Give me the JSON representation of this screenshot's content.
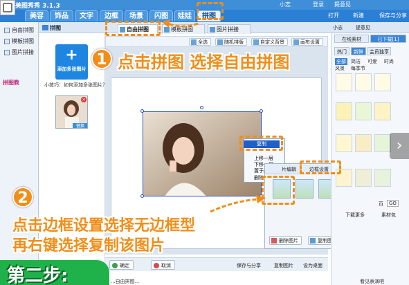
{
  "app": {
    "title": "美图秀秀 3.1.3",
    "user": "小志",
    "links": [
      "登录",
      "提意见"
    ]
  },
  "menu": {
    "tabs": [
      "美容",
      "饰品",
      "文字",
      "边框",
      "场景",
      "闪图",
      "娃娃",
      "拼图"
    ],
    "active": "拼图",
    "actions": {
      "open": "打开",
      "new": "新建",
      "save_share": "保存与分享"
    }
  },
  "subbar": {
    "title": "拼图",
    "user": "小志",
    "feedback": "提意见"
  },
  "sidebar": {
    "items": [
      "自由拼图",
      "模板拼图",
      "图片拼接"
    ],
    "pin_label": "拼图教"
  },
  "mode_tabs": [
    {
      "label": "自由拼图",
      "active": true
    },
    {
      "label": "模板拼图",
      "active": false
    },
    {
      "label": "图片拼接",
      "active": false
    }
  ],
  "left_panel": {
    "add_button": "添加多张图片",
    "tip": "小技巧：如何添加多张图片？",
    "thumb_action": "替换"
  },
  "toolbar": {
    "select_all": "全选",
    "random_layout": "随机排版",
    "custom_bg": "自定义背景",
    "canvas_settings": "画布设置"
  },
  "context_menu": {
    "items": [
      "复制",
      "上移一层",
      "下移一层",
      "置于底层",
      "删除"
    ],
    "selected": "复制"
  },
  "border_popup": {
    "tab_edit": "片编辑",
    "tab_border": "边框设置",
    "delete_btn": "删除图片",
    "copy_btn": "复制图片"
  },
  "bottom": {
    "ok": "确定",
    "cancel": "取消",
    "save_share": "保存与分享",
    "copy_image": "复制图片",
    "set_desktop": "设为桌面"
  },
  "right_panel": {
    "tabs": [
      "在线素材",
      "已下载[1]"
    ],
    "sub_tabs": [
      "热门",
      "新鲜",
      "会员独享"
    ],
    "cats_row1": [
      "全部",
      "简洁",
      "可爱",
      "时尚"
    ],
    "cats_row2": [
      "风景",
      "每季节"
    ],
    "page_label": "页",
    "go_btn": "GO",
    "download_more": "下载更多",
    "material_pack": "素材包"
  },
  "status_bar": {
    "left_text": "...自由拼图...",
    "right_text": "看见表演吧"
  },
  "annotations": {
    "step1_num": "1",
    "step1_text": "点击拼图 选择自由拼图",
    "step2_num": "2",
    "step2_text_line1": "点击边框设置选择无边框型",
    "step2_text_line2": "再右键选择复制该图片",
    "step_banner": "第二步:"
  },
  "colors": {
    "accent": "#f28e18",
    "menu_blue": "#2b7fd4",
    "select_blue": "#1f5fc7",
    "banner_green": "#20b24a"
  }
}
